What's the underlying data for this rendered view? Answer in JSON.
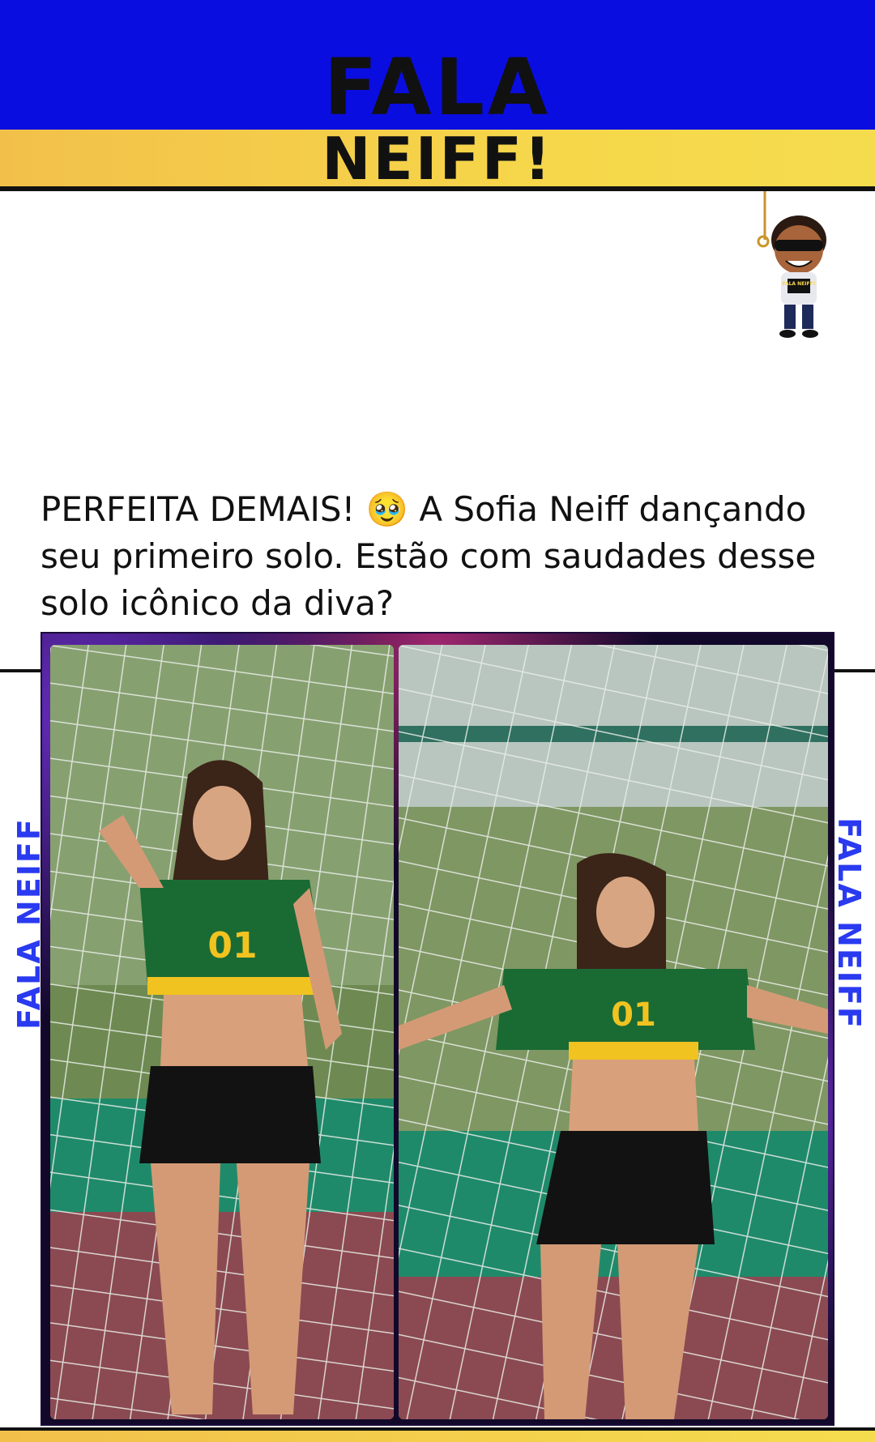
{
  "header": {
    "logo_line1": "FALA",
    "logo_line2": "NEIFF!",
    "colors": {
      "blue": "#0a0de0",
      "yellow": "#f6d64a"
    }
  },
  "mascot": {
    "icon": "cartoon-mascot-icon",
    "shirt_text": "FALA NEIFF!"
  },
  "post": {
    "caption": "PERFEITA DEMAIS! 🥹 A Sofia Neiff dançando seu primeiro solo. Estão com saudades desse solo icônico da diva?"
  },
  "watermark": {
    "left": "FALA NEIFF",
    "right": "FALA NEIFF"
  },
  "photos": [
    {
      "jersey_number": "01"
    },
    {
      "jersey_number": "01"
    }
  ]
}
